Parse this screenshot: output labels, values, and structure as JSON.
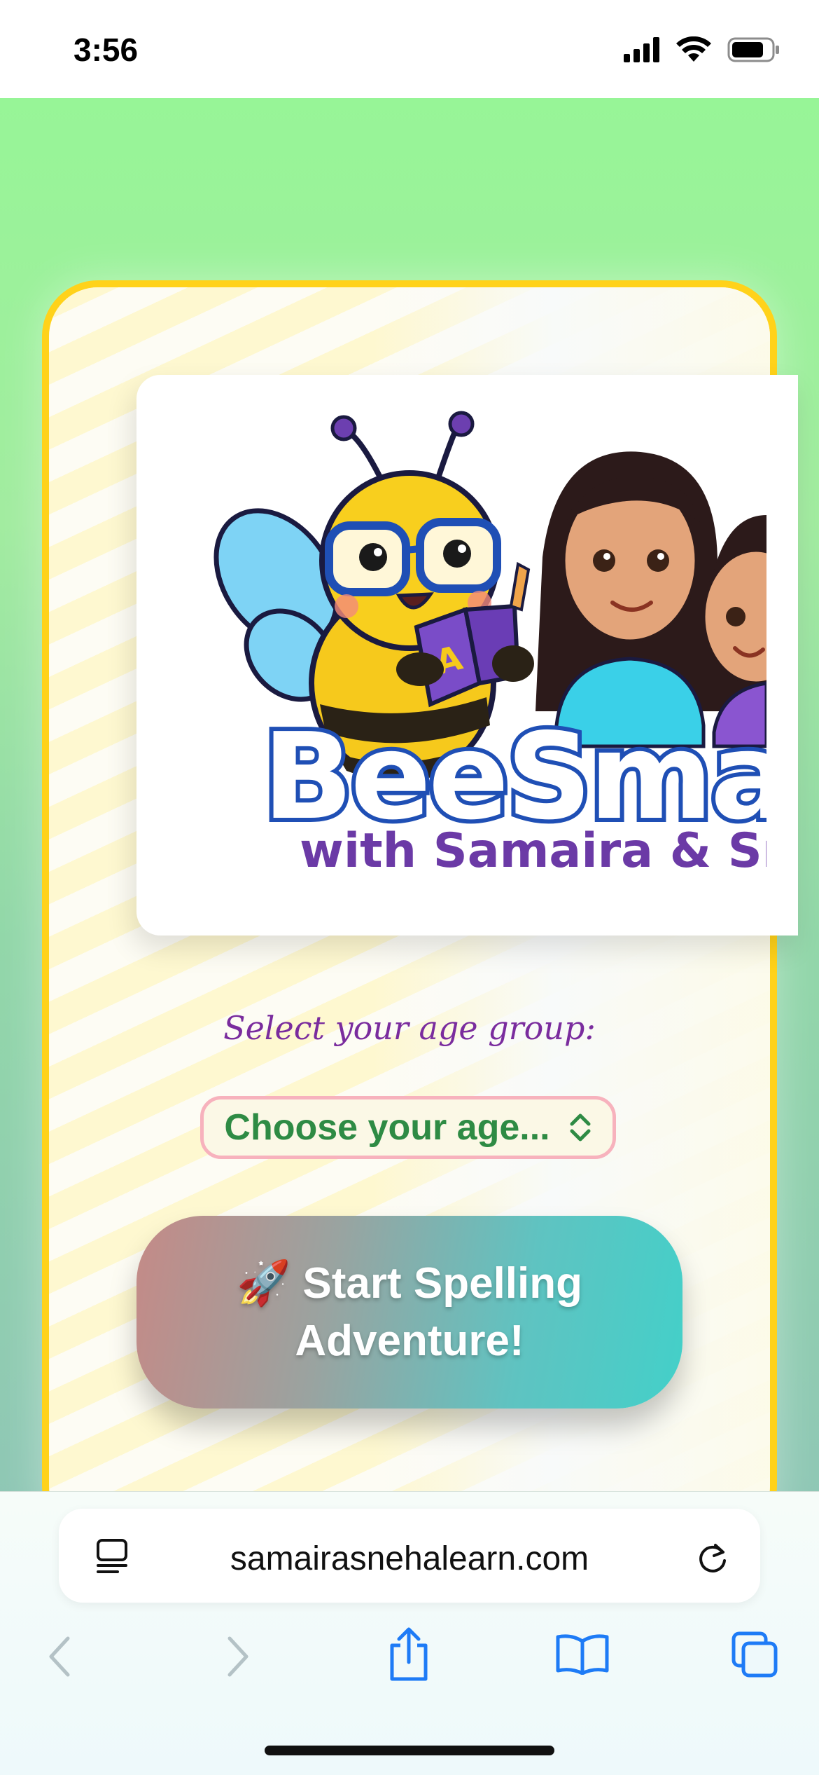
{
  "status_bar": {
    "time": "3:56"
  },
  "logo": {
    "brand": "BeeSmart",
    "subtitle": "with Samaira & Sneha",
    "book_letter": "A"
  },
  "form": {
    "age_label": "Select your age group:",
    "age_select_value": "Choose your age...",
    "start_button_line1": "🚀 Start Spelling",
    "start_button_line2": "Adventure!"
  },
  "browser": {
    "url": "samairasnehalearn.com",
    "icons": [
      "tab-options-icon",
      "reload-icon",
      "back-icon",
      "forward-icon",
      "share-icon",
      "bookmarks-icon",
      "tabs-icon"
    ]
  },
  "colors": {
    "page_gradient_top": "#97f597",
    "card_border": "#ffd21a",
    "brand_outline": "#1f4fb5",
    "subtitle_purple": "#6b3aa6",
    "select_text_green": "#2e8b44",
    "select_border_pink": "#f7b2bd",
    "accent_blue": "#1e7bf6"
  }
}
